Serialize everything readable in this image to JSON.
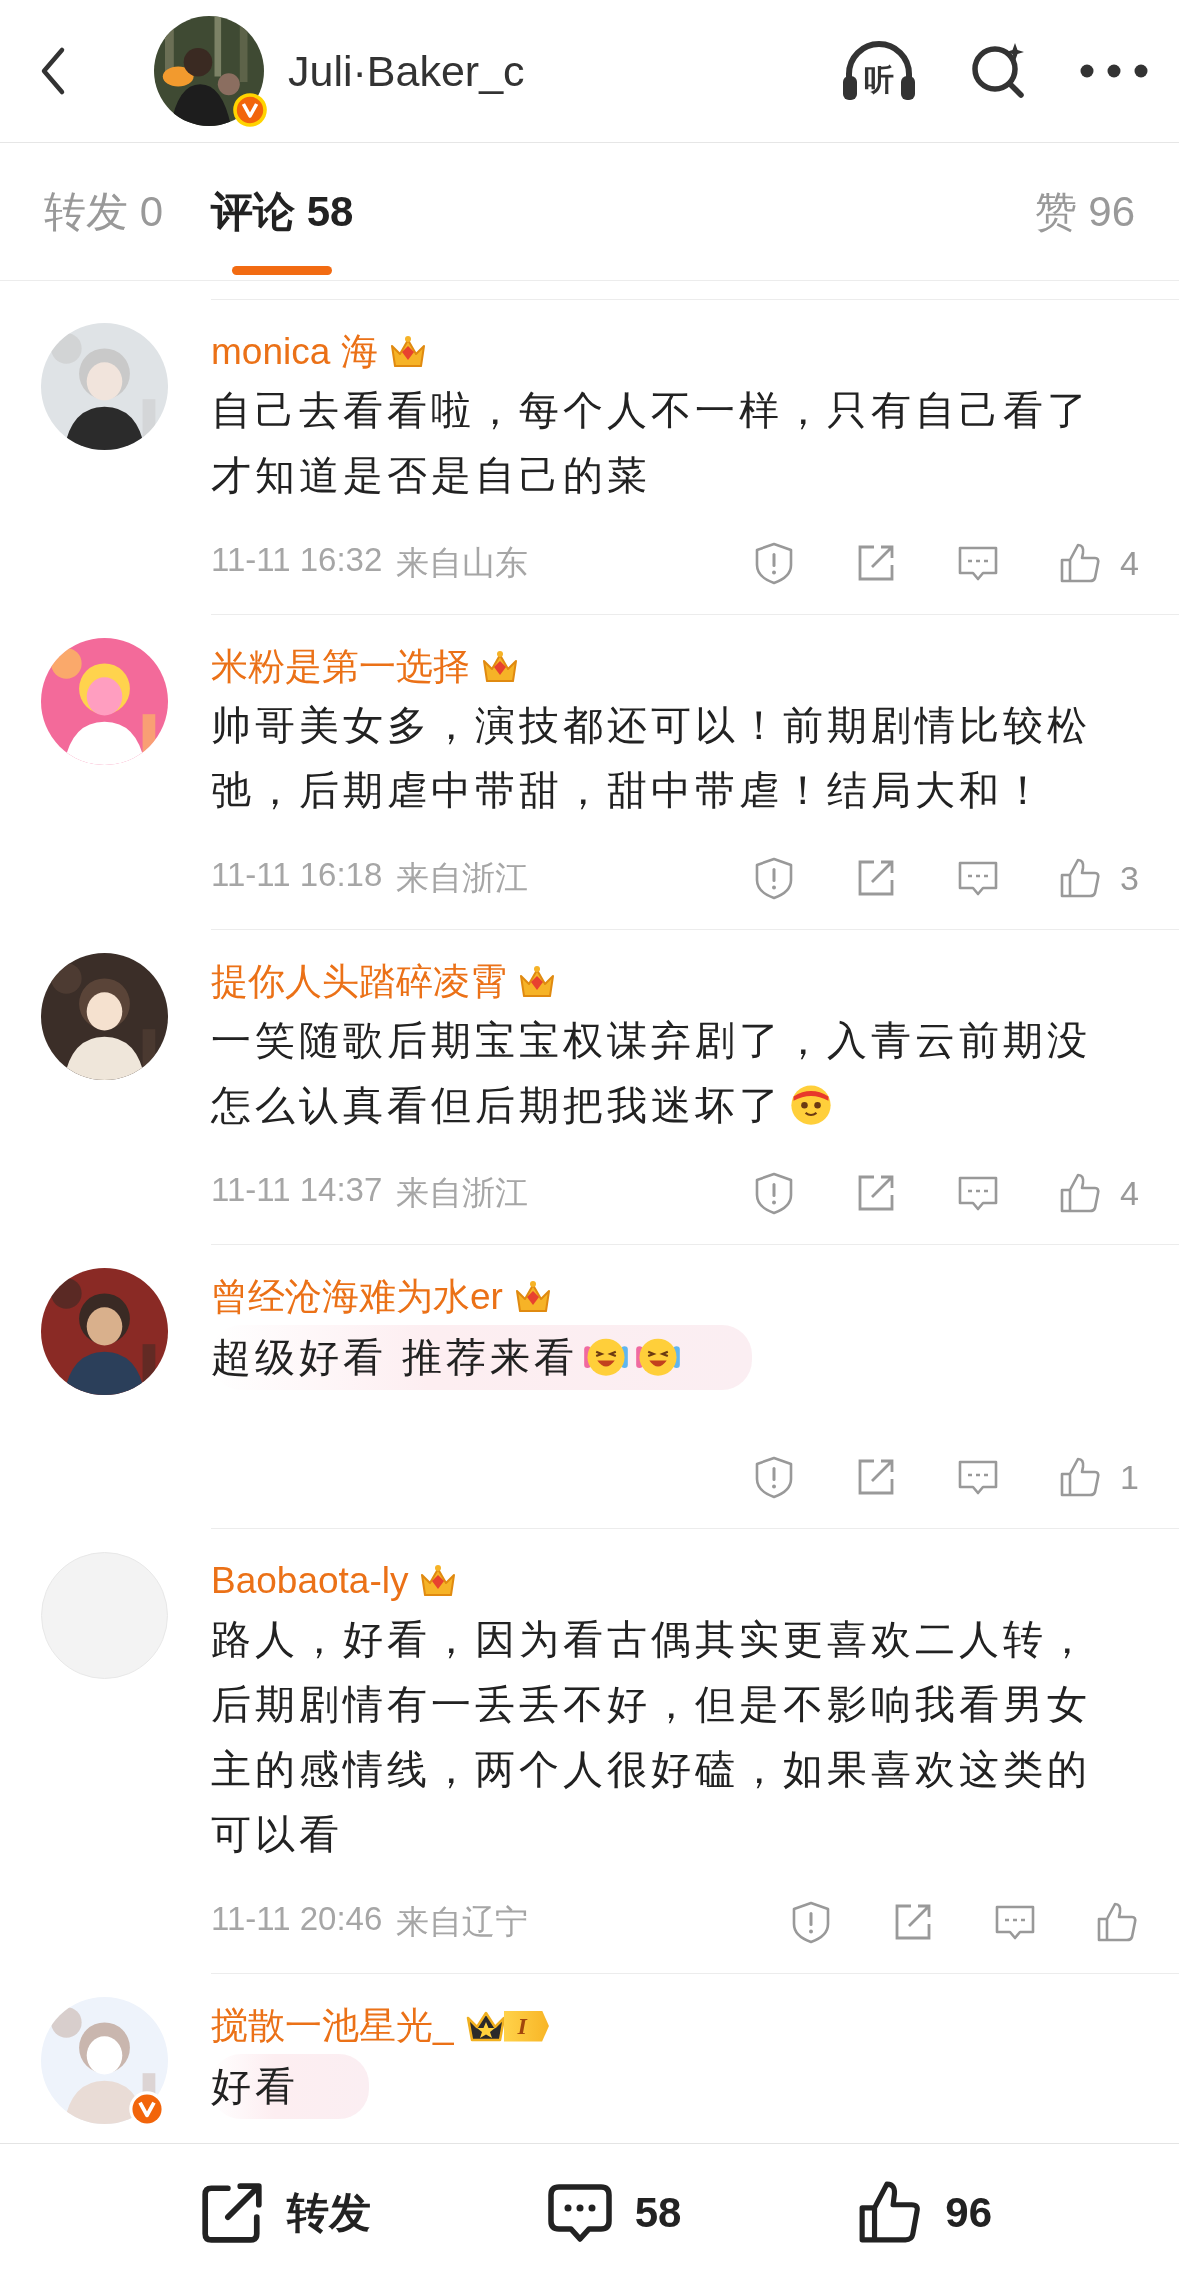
{
  "header": {
    "name": "Juli·Baker_c",
    "avatar": {
      "kind": "picture",
      "verified": true
    },
    "listen_label": "听"
  },
  "tabs": [
    {
      "label": "转发",
      "count": "0",
      "selected": false
    },
    {
      "label": "评论",
      "count": "58",
      "selected": true
    }
  ],
  "likes_tab": {
    "label": "赞",
    "count": "96"
  },
  "comments": [
    {
      "name": "monica 海",
      "avatar": {
        "kind": "picture"
      },
      "verified": false,
      "badge": {
        "kind": "crown"
      },
      "lines": [
        "自己去看看啦，每个人不一样，只有自己看了",
        "才知道是否是自己的菜"
      ],
      "highlighted": false,
      "time": "11-11 16:32",
      "location": "来自山东",
      "likes": "4"
    },
    {
      "name": "米粉是第一选择",
      "avatar": {
        "kind": "picture"
      },
      "verified": false,
      "badge": {
        "kind": "crown"
      },
      "lines": [
        "帅哥美女多，演技都还可以！前期剧情比较松",
        "弛，后期虐中带甜，甜中带虐！结局大和！"
      ],
      "highlighted": false,
      "time": "11-11 16:18",
      "location": "来自浙江",
      "likes": "3"
    },
    {
      "name": "提你人头踏碎凌霄",
      "avatar": {
        "kind": "picture"
      },
      "verified": false,
      "badge": {
        "kind": "crown"
      },
      "lines": [
        "一笑随歌后期宝宝权谋弃剧了，入青云前期没",
        "怎么认真看但后期把我迷坏了"
      ],
      "emojis": [
        {
          "kind": "headband"
        }
      ],
      "highlighted": false,
      "time": "11-11 14:37",
      "location": "来自浙江",
      "likes": "4"
    },
    {
      "name": "曾经沧海难为水er",
      "avatar": {
        "kind": "picture"
      },
      "verified": false,
      "badge": {
        "kind": "crown"
      },
      "lines": [
        "超级好看 推荐来看"
      ],
      "emojis": [
        {
          "kind": "laughing"
        },
        {
          "kind": "laughing"
        }
      ],
      "highlighted": true,
      "likes": "1"
    },
    {
      "name": "Baobaota-ly",
      "avatar": {
        "kind": "blank"
      },
      "verified": false,
      "badge": {
        "kind": "crown"
      },
      "lines": [
        "路人，好看，因为看古偶其实更喜欢二人转，",
        "后期剧情有一丢丢不好，但是不影响我看男女",
        "主的感情线，两个人很好磕，如果喜欢这类的",
        "可以看"
      ],
      "highlighted": false,
      "time": "11-11 20:46",
      "location": "来自辽宁"
    },
    {
      "name": "搅散一池星光_",
      "avatar": {
        "kind": "picture"
      },
      "verified": true,
      "badge": {
        "kind": "star_crown",
        "label": "I"
      },
      "lines": [
        "好看"
      ],
      "highlighted": true
    }
  ],
  "bottom_bar": {
    "share_label": "转发",
    "comments": "58",
    "likes": "96"
  }
}
